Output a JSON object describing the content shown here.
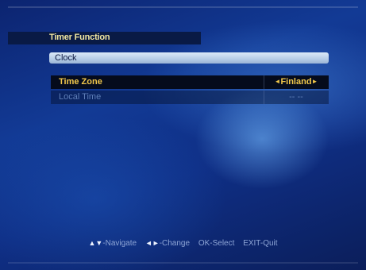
{
  "menu": {
    "title": "Timer Function",
    "section": "Clock",
    "rows": [
      {
        "label": "Time Zone",
        "value": "Finland",
        "left_arrow": "◄",
        "right_arrow": "►"
      },
      {
        "label": "Local Time",
        "value": "-- --"
      }
    ]
  },
  "footer": {
    "navigate_key": "▲▼",
    "navigate_label": "-Navigate",
    "change_key": "◄►",
    "change_label": "-Change",
    "select": "OK-Select",
    "exit": "EXIT-Quit"
  },
  "colors": {
    "highlight_text": "#f2c84b",
    "dim_text": "#5f7fb8",
    "background": "#0f2f86"
  }
}
